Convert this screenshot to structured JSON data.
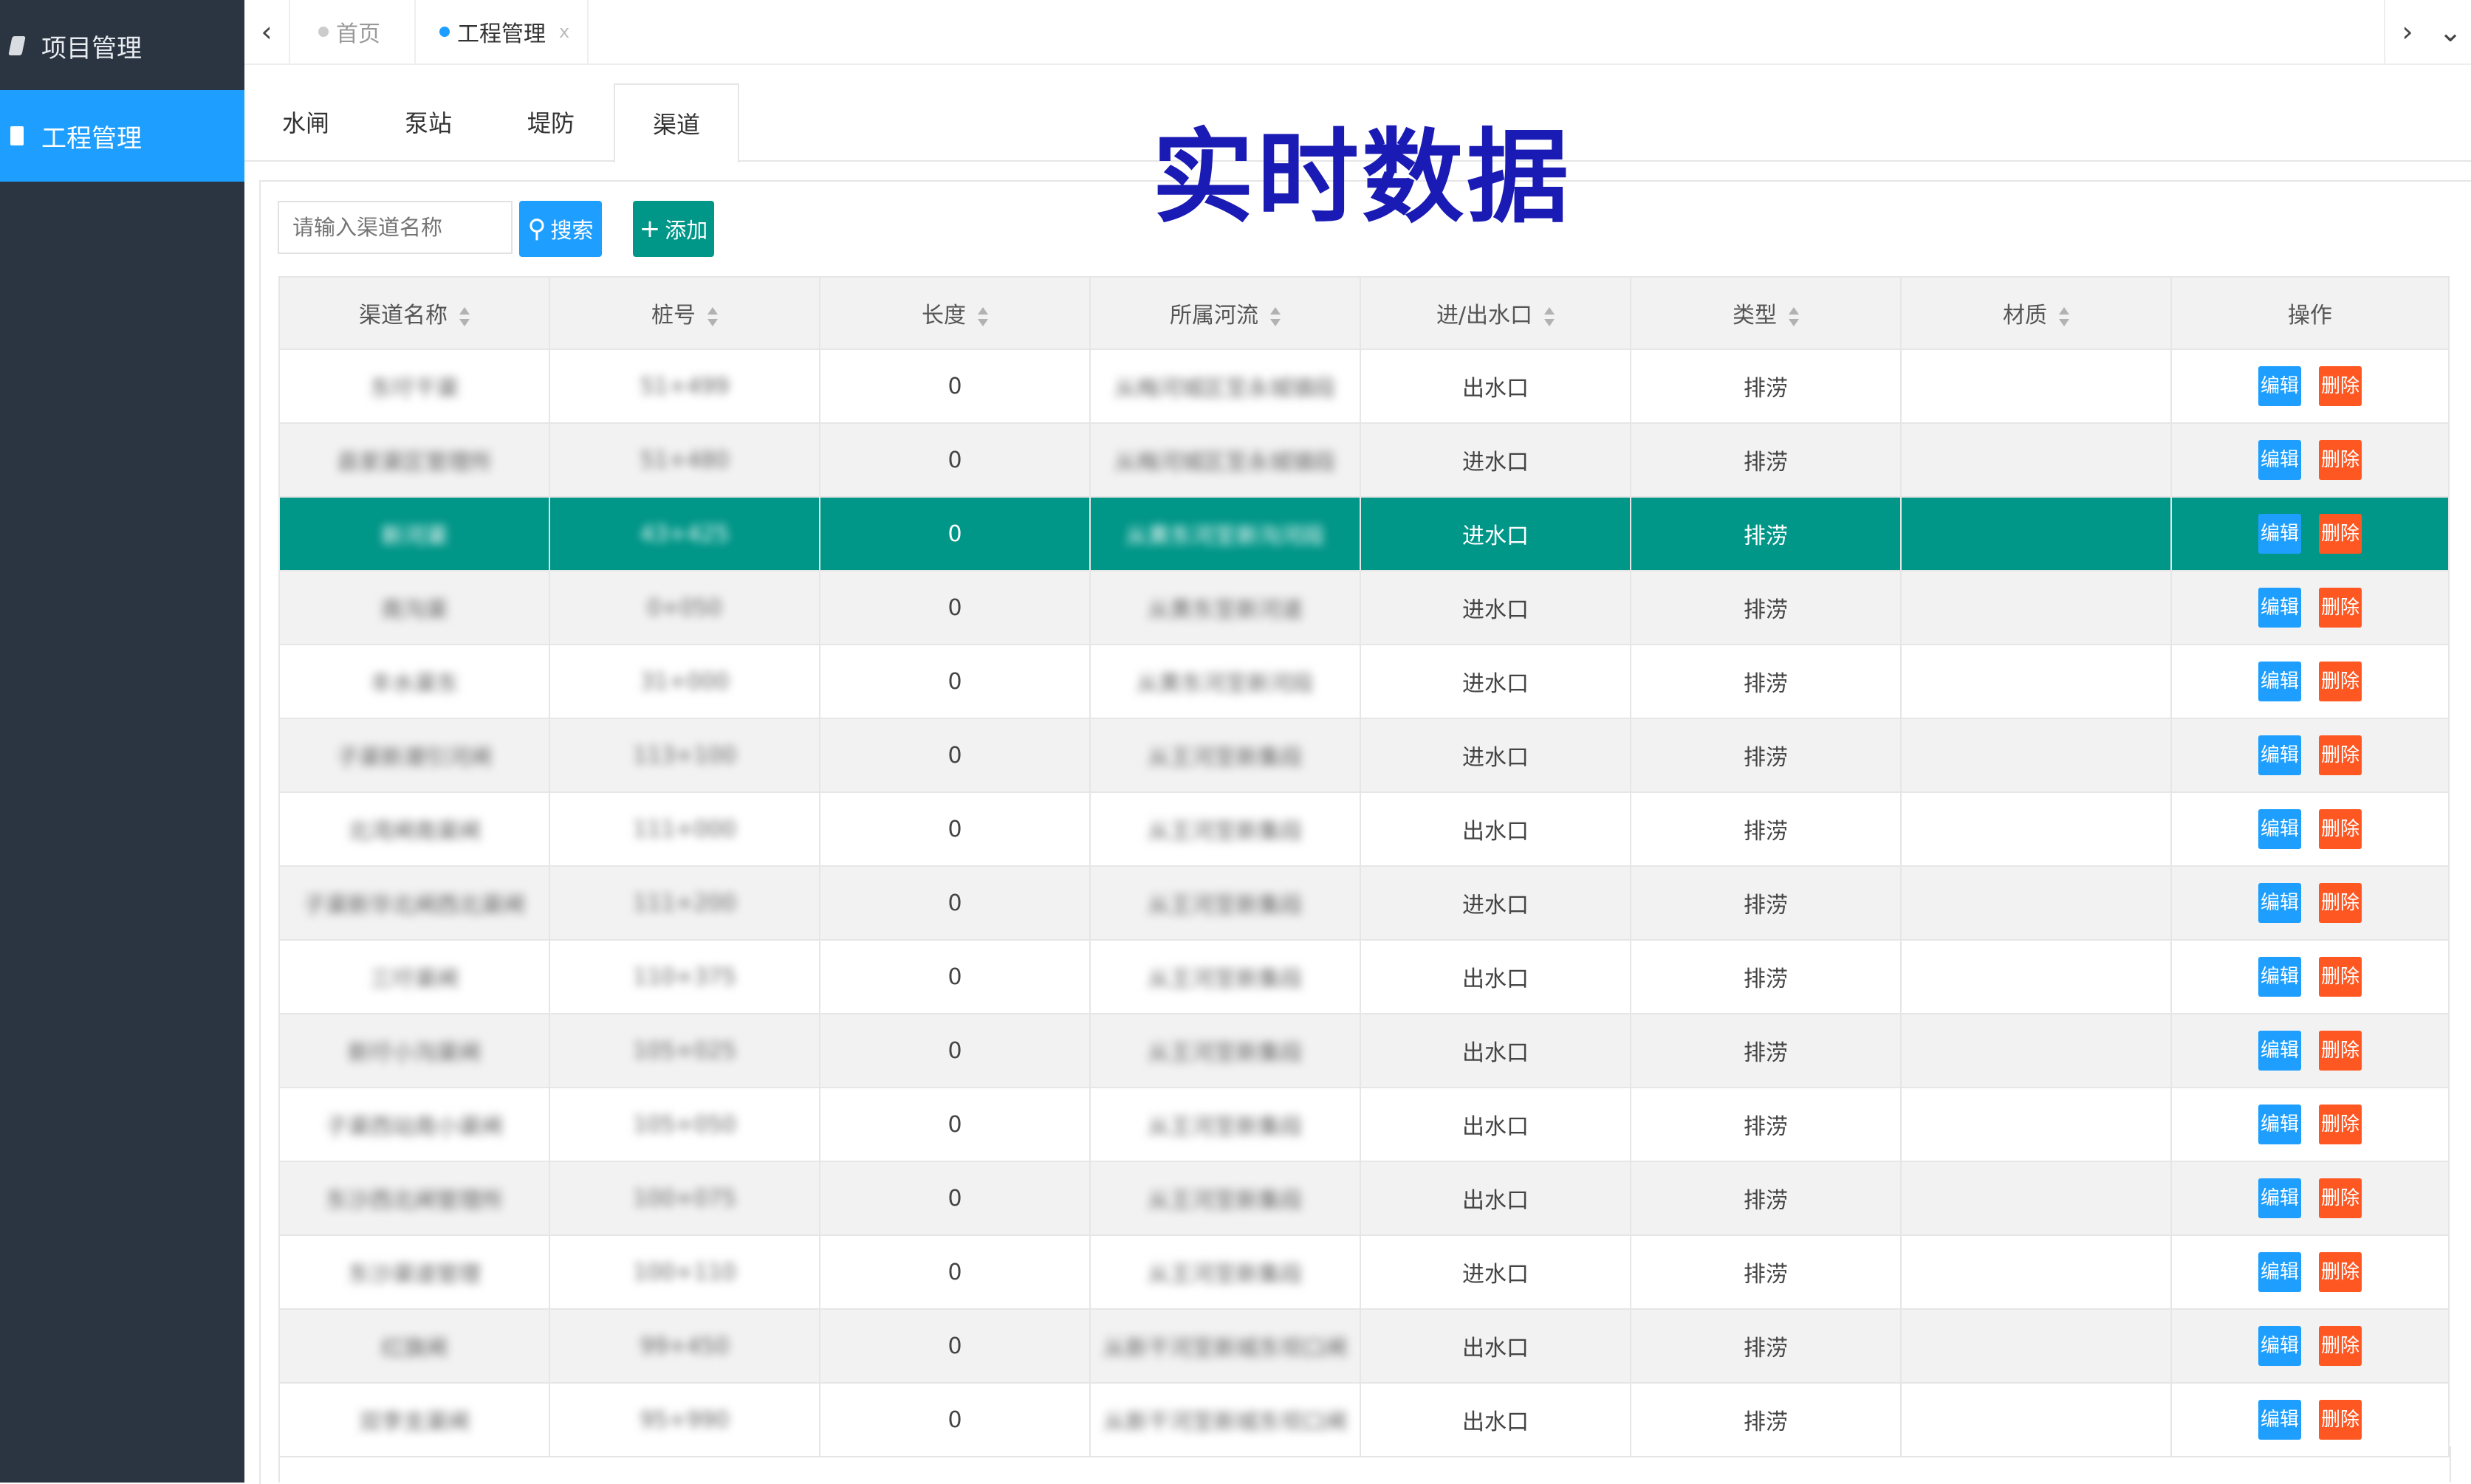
{
  "sidebar": {
    "items": [
      {
        "label": "项目管理",
        "icon": "book-icon",
        "active": false
      },
      {
        "label": "工程管理",
        "icon": "file-icon",
        "active": true
      }
    ]
  },
  "topbar": {
    "tabs": [
      {
        "label": "首页",
        "closable": false
      },
      {
        "label": "工程管理",
        "closable": true,
        "close": "x"
      }
    ],
    "prev_glyph": "‹",
    "next_glyph": "›",
    "more_glyph": "⌄"
  },
  "subtabs": [
    {
      "label": "水闸"
    },
    {
      "label": "泵站"
    },
    {
      "label": "堤防"
    },
    {
      "label": "渠道",
      "active": true
    }
  ],
  "banner": "实时数据",
  "toolbar": {
    "search_placeholder": "请输入渠道名称",
    "search_label": "搜索",
    "add_label": "添加"
  },
  "table": {
    "columns": [
      "渠道名称",
      "桩号",
      "长度",
      "所属河流",
      "进/出水口",
      "类型",
      "材质",
      "操作"
    ],
    "rows": [
      {
        "name": "东圩干渠",
        "stake": "51+499",
        "length": "0",
        "river": "从梅河城区至永城镇段",
        "port": "出水口",
        "type": "排涝",
        "material": ""
      },
      {
        "name": "县家渠区管理所",
        "stake": "51+480",
        "length": "0",
        "river": "从梅河城区至永城镇段",
        "port": "进水口",
        "type": "排涝",
        "material": ""
      },
      {
        "name": "新河渠",
        "stake": "43+425",
        "length": "0",
        "river": "从黄东河至新沟河段",
        "port": "进水口",
        "type": "排涝",
        "material": ""
      },
      {
        "name": "南沟渠",
        "stake": "0+050",
        "length": "0",
        "river": "从黄东至新河道",
        "port": "进水口",
        "type": "排涝",
        "material": ""
      },
      {
        "name": "丰水渠东",
        "stake": "31+000",
        "length": "0",
        "river": "从黄东河至新河段",
        "port": "进水口",
        "type": "排涝",
        "material": ""
      },
      {
        "name": "子渠新潮引河闸",
        "stake": "113+100",
        "length": "0",
        "river": "从王河至新集段",
        "port": "进水口",
        "type": "排涝",
        "material": ""
      },
      {
        "name": "北湾闸南渠闸",
        "stake": "111+000",
        "length": "0",
        "river": "从王河至新集段",
        "port": "出水口",
        "type": "排涝",
        "material": ""
      },
      {
        "name": "子渠新华北闸西北渠闸",
        "stake": "111+200",
        "length": "0",
        "river": "从王河至新集段",
        "port": "进水口",
        "type": "排涝",
        "material": ""
      },
      {
        "name": "三圩渠闸",
        "stake": "110+375",
        "length": "0",
        "river": "从王河至新集段",
        "port": "出水口",
        "type": "排涝",
        "material": ""
      },
      {
        "name": "新圩小沟渠闸",
        "stake": "105+025",
        "length": "0",
        "river": "从王河至新集段",
        "port": "出水口",
        "type": "排涝",
        "material": ""
      },
      {
        "name": "子渠西站南小渠闸",
        "stake": "105+050",
        "length": "0",
        "river": "从王河至新集段",
        "port": "出水口",
        "type": "排涝",
        "material": ""
      },
      {
        "name": "东沙西北闸管理所",
        "stake": "100+075",
        "length": "0",
        "river": "从王河至新集段",
        "port": "出水口",
        "type": "排涝",
        "material": ""
      },
      {
        "name": "东沙渠道管理",
        "stake": "100+110",
        "length": "0",
        "river": "从王河至新集段",
        "port": "进水口",
        "type": "排涝",
        "material": ""
      },
      {
        "name": "红旗闸",
        "stake": "99+450",
        "length": "0",
        "river": "从新干河至新城东坝口闸",
        "port": "出水口",
        "type": "排涝",
        "material": ""
      },
      {
        "name": "双李支渠闸",
        "stake": "95+990",
        "length": "0",
        "river": "从新干河至新城东坝口闸",
        "port": "出水口",
        "type": "排涝",
        "material": ""
      }
    ],
    "selected_row": 2,
    "actions": {
      "edit": "编辑",
      "delete": "删除"
    }
  },
  "colors": {
    "sidebar_bg": "#2b3541",
    "accent_blue": "#1e9fff",
    "accent_teal": "#009688",
    "delete_orange": "#ff5722",
    "banner_text": "#1a1ab4"
  }
}
